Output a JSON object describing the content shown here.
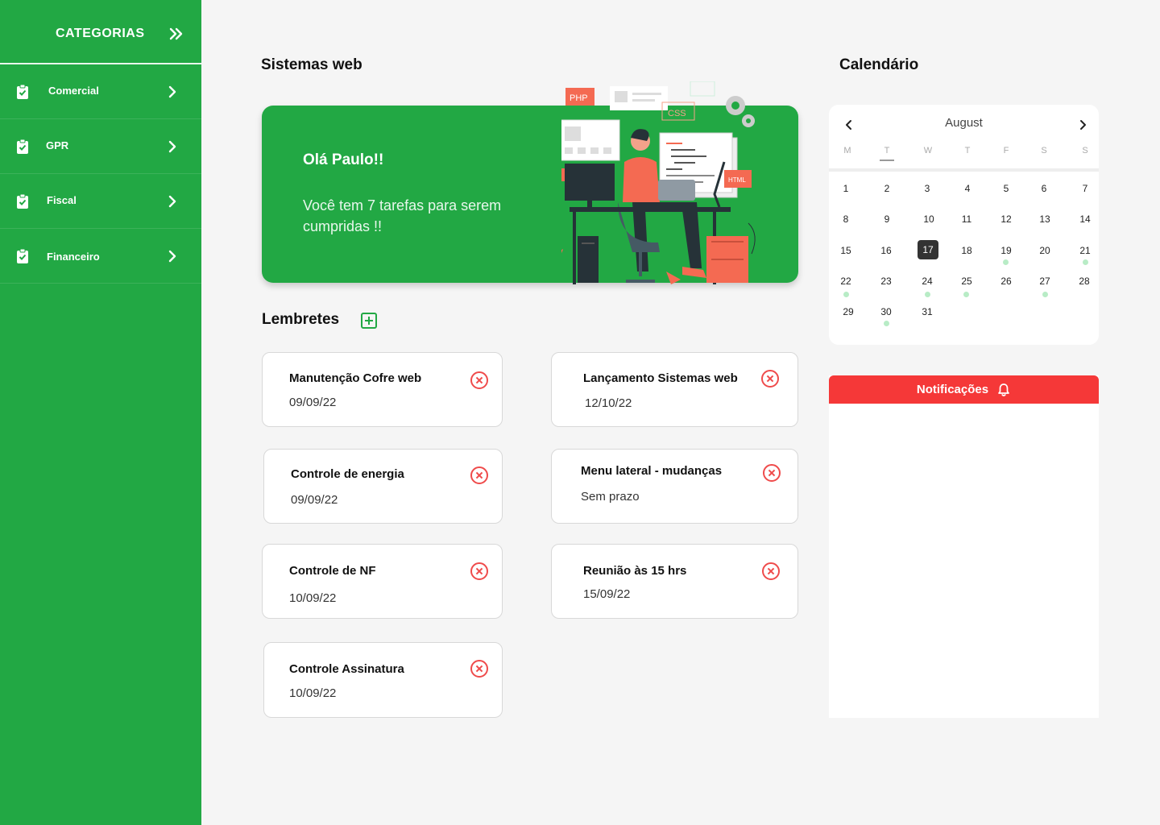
{
  "sidebar": {
    "title": "CATEGORIAS",
    "items": [
      {
        "label": "Comercial"
      },
      {
        "label": "GPR"
      },
      {
        "label": "Fiscal"
      },
      {
        "label": "Financeiro"
      }
    ]
  },
  "main": {
    "section_title": "Sistemas web",
    "banner": {
      "greeting": "Olá Paulo!!",
      "message": "Você tem 7 tarefas para serem cumpridas !!",
      "tags": {
        "php": "PHP",
        "css": "CSS",
        "html": "HTML"
      }
    },
    "reminders": {
      "title": "Lembretes",
      "items": [
        {
          "title": "Manutenção Cofre web",
          "date": "09/09/22"
        },
        {
          "title": "Lançamento Sistemas web",
          "date": "12/10/22"
        },
        {
          "title": "Controle de energia",
          "date": "09/09/22"
        },
        {
          "title": "Menu lateral - mudanças",
          "date": "Sem prazo"
        },
        {
          "title": "Controle de NF",
          "date": "10/09/22"
        },
        {
          "title": "Reunião às 15 hrs",
          "date": "15/09/22"
        },
        {
          "title": "Controle Assinatura",
          "date": "10/09/22"
        }
      ]
    }
  },
  "calendar": {
    "title": "Calendário",
    "month": "August",
    "weekdays": [
      "M",
      "T",
      "W",
      "T",
      "F",
      "S",
      "S"
    ],
    "days": [
      "1",
      "2",
      "3",
      "4",
      "5",
      "6",
      "7",
      "8",
      "9",
      "10",
      "11",
      "12",
      "13",
      "14",
      "15",
      "16",
      "17",
      "18",
      "19",
      "20",
      "21",
      "22",
      "23",
      "24",
      "25",
      "26",
      "27",
      "28",
      "29",
      "30",
      "31"
    ],
    "selected_day": "17"
  },
  "notifications": {
    "title": "Notificações"
  },
  "colors": {
    "brand_green": "#22a844",
    "alert_red": "#f53838",
    "close_red": "#ef4b4b"
  }
}
